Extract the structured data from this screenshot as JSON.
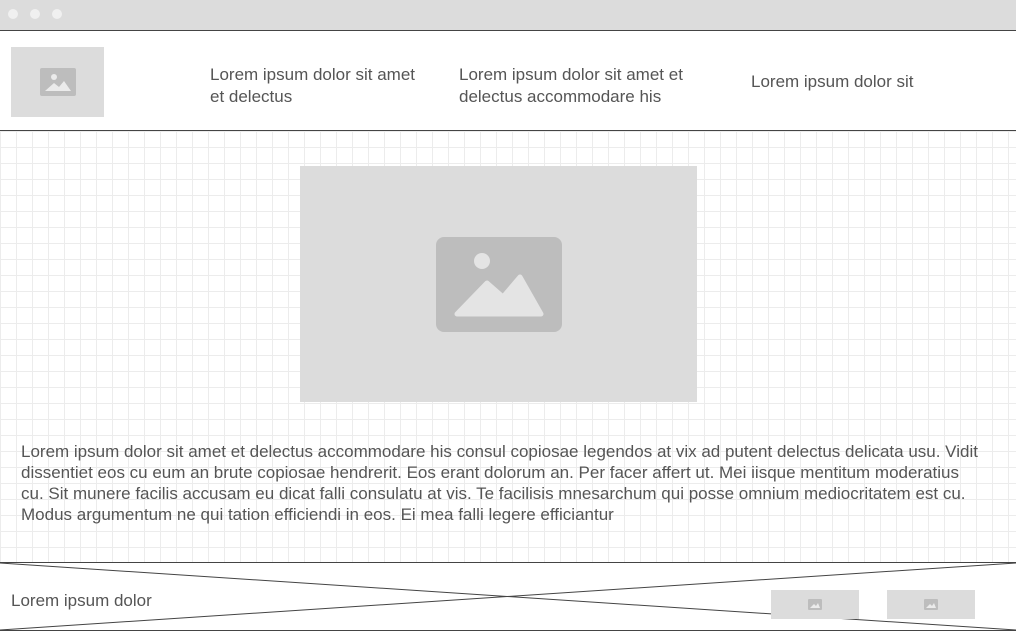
{
  "window": {
    "controls": [
      "window-dot",
      "window-dot",
      "window-dot"
    ]
  },
  "header": {
    "logo_icon": "image-placeholder-icon",
    "nav": [
      {
        "label": "Lorem ipsum dolor sit amet et delectus"
      },
      {
        "label": "Lorem ipsum dolor sit amet et delectus accommodare his"
      },
      {
        "label": "Lorem ipsum dolor sit"
      }
    ]
  },
  "main": {
    "hero_icon": "image-placeholder-icon",
    "paragraph": "Lorem ipsum dolor sit amet et delectus accommodare his consul copiosae legendos at vix ad putent delectus delicata usu. Vidit dissentiet eos cu eum an brute copiosae hendrerit. Eos erant dolorum an. Per facer affert ut. Mei iisque mentitum moderatius cu. Sit munere facilis accusam eu dicat falli consulatu at vis. Te facilisis mnesarchum qui posse omnium mediocritatem est cu. Modus argumentum ne qui tation efficiendi in eos. Ei mea falli legere efficiantur"
  },
  "footer": {
    "text": "Lorem ipsum dolor",
    "thumbnail_icon": "image-placeholder-icon"
  },
  "colors": {
    "placeholder": "#dcdcdc",
    "icon": "#bdbdbd",
    "text": "#555555",
    "border": "#444444"
  }
}
